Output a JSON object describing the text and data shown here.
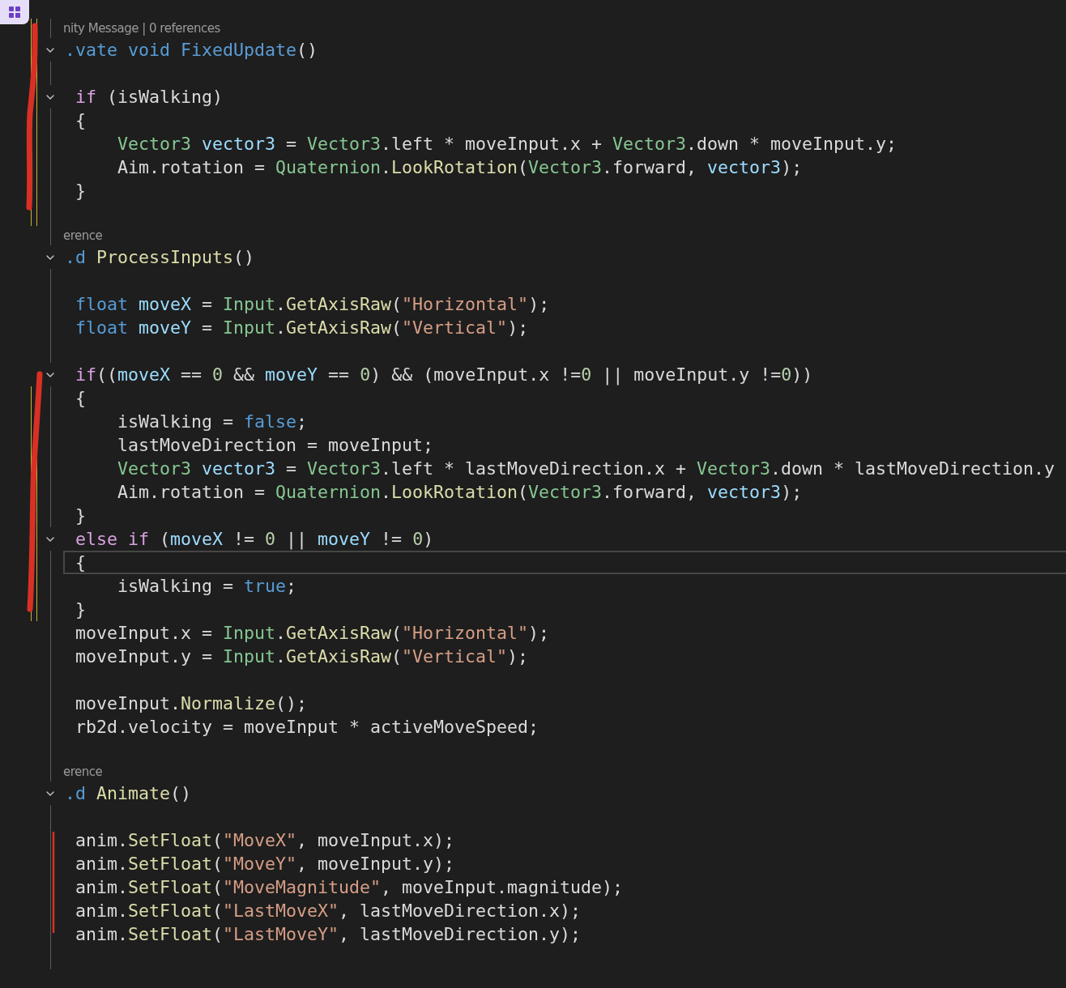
{
  "lines": [
    {
      "kind": "lens",
      "text": "nity Message | 0 references",
      "modified": true
    },
    {
      "kind": "code",
      "expanded": true,
      "modified": true,
      "tokens": [
        {
          "kind": "keyword",
          "text": ".vate void "
        },
        {
          "kind": "message",
          "text": "FixedUpdate"
        },
        {
          "kind": "plain",
          "text": "()"
        }
      ]
    },
    {
      "kind": "blank",
      "modified": true
    },
    {
      "kind": "code",
      "expanded": true,
      "modified": true,
      "tokens": [
        {
          "kind": "control",
          "text": " if"
        },
        {
          "kind": "plain",
          "text": " (isWalking)"
        }
      ]
    },
    {
      "kind": "code",
      "modified": true,
      "tokens": [
        {
          "kind": "plain",
          "text": " {"
        }
      ]
    },
    {
      "kind": "code",
      "modified": true,
      "tokens": [
        {
          "kind": "type",
          "text": "     Vector3"
        },
        {
          "kind": "variable",
          "text": " vector3"
        },
        {
          "kind": "plain",
          "text": " = "
        },
        {
          "kind": "type",
          "text": "Vector3"
        },
        {
          "kind": "plain",
          "text": ".left * moveInput.x + "
        },
        {
          "kind": "type",
          "text": "Vector3"
        },
        {
          "kind": "plain",
          "text": ".down * moveInput.y;"
        }
      ]
    },
    {
      "kind": "code",
      "modified": true,
      "tokens": [
        {
          "kind": "plain",
          "text": "     Aim.rotation = "
        },
        {
          "kind": "type",
          "text": "Quaternion"
        },
        {
          "kind": "plain",
          "text": "."
        },
        {
          "kind": "method",
          "text": "LookRotation"
        },
        {
          "kind": "plain",
          "text": "("
        },
        {
          "kind": "type",
          "text": "Vector3"
        },
        {
          "kind": "plain",
          "text": ".forward, "
        },
        {
          "kind": "variable",
          "text": "vector3"
        },
        {
          "kind": "plain",
          "text": ");"
        }
      ]
    },
    {
      "kind": "code",
      "modified": true,
      "tokens": [
        {
          "kind": "plain",
          "text": " }"
        }
      ]
    },
    {
      "kind": "blank",
      "modified": true
    },
    {
      "kind": "lens",
      "text": "erence",
      "modified": false
    },
    {
      "kind": "code",
      "expanded": true,
      "modified": false,
      "tokens": [
        {
          "kind": "keyword",
          "text": ".d"
        },
        {
          "kind": "method",
          "text": " ProcessInputs"
        },
        {
          "kind": "plain",
          "text": "()"
        }
      ]
    },
    {
      "kind": "blank",
      "modified": false
    },
    {
      "kind": "code",
      "modified": false,
      "tokens": [
        {
          "kind": "keyword",
          "text": " float"
        },
        {
          "kind": "variable",
          "text": " moveX"
        },
        {
          "kind": "plain",
          "text": " = "
        },
        {
          "kind": "type",
          "text": "Input"
        },
        {
          "kind": "plain",
          "text": "."
        },
        {
          "kind": "method",
          "text": "GetAxisRaw"
        },
        {
          "kind": "plain",
          "text": "("
        },
        {
          "kind": "string",
          "text": "\"Horizontal\""
        },
        {
          "kind": "plain",
          "text": ");"
        }
      ]
    },
    {
      "kind": "code",
      "modified": false,
      "tokens": [
        {
          "kind": "keyword",
          "text": " float"
        },
        {
          "kind": "variable",
          "text": " moveY"
        },
        {
          "kind": "plain",
          "text": " = "
        },
        {
          "kind": "type",
          "text": "Input"
        },
        {
          "kind": "plain",
          "text": "."
        },
        {
          "kind": "method",
          "text": "GetAxisRaw"
        },
        {
          "kind": "plain",
          "text": "("
        },
        {
          "kind": "string",
          "text": "\"Vertical\""
        },
        {
          "kind": "plain",
          "text": ");"
        }
      ]
    },
    {
      "kind": "blank",
      "modified": false
    },
    {
      "kind": "code",
      "expanded": true,
      "modified": false,
      "tokens": [
        {
          "kind": "control",
          "text": " if"
        },
        {
          "kind": "plain",
          "text": "(("
        },
        {
          "kind": "variable",
          "text": "moveX"
        },
        {
          "kind": "plain",
          "text": " == "
        },
        {
          "kind": "number",
          "text": "0"
        },
        {
          "kind": "plain",
          "text": " && "
        },
        {
          "kind": "variable",
          "text": "moveY"
        },
        {
          "kind": "plain",
          "text": " == "
        },
        {
          "kind": "number",
          "text": "0"
        },
        {
          "kind": "plain",
          "text": ") && (moveInput.x !="
        },
        {
          "kind": "number",
          "text": "0"
        },
        {
          "kind": "plain",
          "text": " || moveInput.y !="
        },
        {
          "kind": "number",
          "text": "0"
        },
        {
          "kind": "plain",
          "text": "))"
        }
      ]
    },
    {
      "kind": "code",
      "modified": true,
      "tokens": [
        {
          "kind": "plain",
          "text": " {"
        }
      ]
    },
    {
      "kind": "code",
      "modified": true,
      "tokens": [
        {
          "kind": "plain",
          "text": "     isWalking = "
        },
        {
          "kind": "keyword",
          "text": "false"
        },
        {
          "kind": "plain",
          "text": ";"
        }
      ]
    },
    {
      "kind": "code",
      "modified": true,
      "tokens": [
        {
          "kind": "plain",
          "text": "     lastMoveDirection = moveInput;"
        }
      ]
    },
    {
      "kind": "code",
      "modified": true,
      "tokens": [
        {
          "kind": "type",
          "text": "     Vector3"
        },
        {
          "kind": "variable",
          "text": " vector3"
        },
        {
          "kind": "plain",
          "text": " = "
        },
        {
          "kind": "type",
          "text": "Vector3"
        },
        {
          "kind": "plain",
          "text": ".left * lastMoveDirection.x + "
        },
        {
          "kind": "type",
          "text": "Vector3"
        },
        {
          "kind": "plain",
          "text": ".down * lastMoveDirection.y"
        }
      ]
    },
    {
      "kind": "code",
      "modified": true,
      "tokens": [
        {
          "kind": "plain",
          "text": "     Aim.rotation = "
        },
        {
          "kind": "type",
          "text": "Quaternion"
        },
        {
          "kind": "plain",
          "text": "."
        },
        {
          "kind": "method",
          "text": "LookRotation"
        },
        {
          "kind": "plain",
          "text": "("
        },
        {
          "kind": "type",
          "text": "Vector3"
        },
        {
          "kind": "plain",
          "text": ".forward, "
        },
        {
          "kind": "variable",
          "text": "vector3"
        },
        {
          "kind": "plain",
          "text": ");"
        }
      ]
    },
    {
      "kind": "code",
      "modified": true,
      "tokens": [
        {
          "kind": "plain",
          "text": " }"
        }
      ]
    },
    {
      "kind": "code",
      "expanded": true,
      "modified": true,
      "tokens": [
        {
          "kind": "control",
          "text": " else if"
        },
        {
          "kind": "plain",
          "text": " ("
        },
        {
          "kind": "variable",
          "text": "moveX"
        },
        {
          "kind": "plain",
          "text": " != "
        },
        {
          "kind": "number",
          "text": "0"
        },
        {
          "kind": "plain",
          "text": " || "
        },
        {
          "kind": "variable",
          "text": "moveY"
        },
        {
          "kind": "plain",
          "text": " != "
        },
        {
          "kind": "number",
          "text": "0"
        },
        {
          "kind": "plain",
          "text": ")"
        }
      ]
    },
    {
      "kind": "code",
      "modified": true,
      "current": true,
      "tokens": [
        {
          "kind": "plain",
          "text": " {"
        }
      ]
    },
    {
      "kind": "code",
      "modified": true,
      "tokens": [
        {
          "kind": "plain",
          "text": "     isWalking = "
        },
        {
          "kind": "keyword",
          "text": "true"
        },
        {
          "kind": "plain",
          "text": ";"
        }
      ]
    },
    {
      "kind": "code",
      "modified": true,
      "tokens": [
        {
          "kind": "plain",
          "text": " }"
        }
      ]
    },
    {
      "kind": "code",
      "modified": false,
      "tokens": [
        {
          "kind": "plain",
          "text": " moveInput.x = "
        },
        {
          "kind": "type",
          "text": "Input"
        },
        {
          "kind": "plain",
          "text": "."
        },
        {
          "kind": "method",
          "text": "GetAxisRaw"
        },
        {
          "kind": "plain",
          "text": "("
        },
        {
          "kind": "string",
          "text": "\"Horizontal\""
        },
        {
          "kind": "plain",
          "text": ");"
        }
      ]
    },
    {
      "kind": "code",
      "modified": false,
      "tokens": [
        {
          "kind": "plain",
          "text": " moveInput.y = "
        },
        {
          "kind": "type",
          "text": "Input"
        },
        {
          "kind": "plain",
          "text": "."
        },
        {
          "kind": "method",
          "text": "GetAxisRaw"
        },
        {
          "kind": "plain",
          "text": "("
        },
        {
          "kind": "string",
          "text": "\"Vertical\""
        },
        {
          "kind": "plain",
          "text": ");"
        }
      ]
    },
    {
      "kind": "blank",
      "modified": false
    },
    {
      "kind": "code",
      "modified": false,
      "tokens": [
        {
          "kind": "plain",
          "text": " moveInput."
        },
        {
          "kind": "method",
          "text": "Normalize"
        },
        {
          "kind": "plain",
          "text": "();"
        }
      ]
    },
    {
      "kind": "code",
      "modified": false,
      "tokens": [
        {
          "kind": "plain",
          "text": " rb2d.velocity = moveInput * activeMoveSpeed;"
        }
      ]
    },
    {
      "kind": "blank",
      "modified": false
    },
    {
      "kind": "lens",
      "text": "erence",
      "modified": false
    },
    {
      "kind": "code",
      "expanded": true,
      "modified": false,
      "tokens": [
        {
          "kind": "keyword",
          "text": ".d"
        },
        {
          "kind": "method",
          "text": " Animate"
        },
        {
          "kind": "plain",
          "text": "()"
        }
      ]
    },
    {
      "kind": "blank",
      "modified": false
    },
    {
      "kind": "code",
      "modified": false,
      "tokens": [
        {
          "kind": "plain",
          "text": " anim."
        },
        {
          "kind": "method",
          "text": "SetFloat"
        },
        {
          "kind": "plain",
          "text": "("
        },
        {
          "kind": "string",
          "text": "\"MoveX\""
        },
        {
          "kind": "plain",
          "text": ", moveInput.x);"
        }
      ]
    },
    {
      "kind": "code",
      "modified": false,
      "tokens": [
        {
          "kind": "plain",
          "text": " anim."
        },
        {
          "kind": "method",
          "text": "SetFloat"
        },
        {
          "kind": "plain",
          "text": "("
        },
        {
          "kind": "string",
          "text": "\"MoveY\""
        },
        {
          "kind": "plain",
          "text": ", moveInput.y);"
        }
      ]
    },
    {
      "kind": "code",
      "modified": false,
      "tokens": [
        {
          "kind": "plain",
          "text": " anim."
        },
        {
          "kind": "method",
          "text": "SetFloat"
        },
        {
          "kind": "plain",
          "text": "("
        },
        {
          "kind": "string",
          "text": "\"MoveMagnitude\""
        },
        {
          "kind": "plain",
          "text": ", moveInput.magnitude);"
        }
      ]
    },
    {
      "kind": "code",
      "modified": false,
      "tokens": [
        {
          "kind": "plain",
          "text": " anim."
        },
        {
          "kind": "method",
          "text": "SetFloat"
        },
        {
          "kind": "plain",
          "text": "("
        },
        {
          "kind": "string",
          "text": "\"LastMoveX\""
        },
        {
          "kind": "plain",
          "text": ", lastMoveDirection.x);"
        }
      ]
    },
    {
      "kind": "code",
      "modified": false,
      "tokens": [
        {
          "kind": "plain",
          "text": " anim."
        },
        {
          "kind": "method",
          "text": "SetFloat"
        },
        {
          "kind": "plain",
          "text": "("
        },
        {
          "kind": "string",
          "text": "\"LastMoveY\""
        },
        {
          "kind": "plain",
          "text": ", lastMoveDirection.y);"
        }
      ]
    },
    {
      "kind": "blank",
      "modified": false
    }
  ]
}
